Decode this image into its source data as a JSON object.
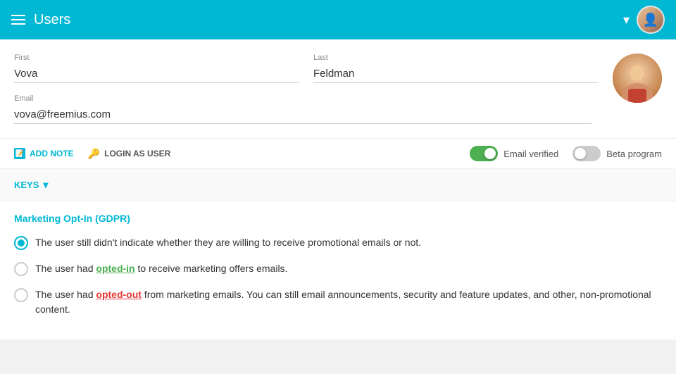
{
  "header": {
    "title": "Users",
    "chevron": "▾"
  },
  "form": {
    "first_label": "First",
    "first_value": "Vova",
    "last_label": "Last",
    "last_value": "Feldman",
    "email_label": "Email",
    "email_value": "vova@freemius.com"
  },
  "actions": {
    "add_note_label": "ADD NOTE",
    "login_as_user_label": "LOGIN AS USER",
    "email_verified_label": "Email verified",
    "beta_program_label": "Beta program"
  },
  "keys": {
    "label": "KEYS",
    "chevron": "▾"
  },
  "marketing": {
    "title": "Marketing Opt-In (GDPR)",
    "option1": "The user still didn't indicate whether they are willing to receive promotional emails or not.",
    "option2_pre": "The user had ",
    "option2_link": "opted-in",
    "option2_post": " to receive marketing offers emails.",
    "option3_pre": "The user had ",
    "option3_link": "opted-out",
    "option3_post": " from marketing emails. You can still email announcements, security and feature updates, and other, non-promotional content."
  }
}
